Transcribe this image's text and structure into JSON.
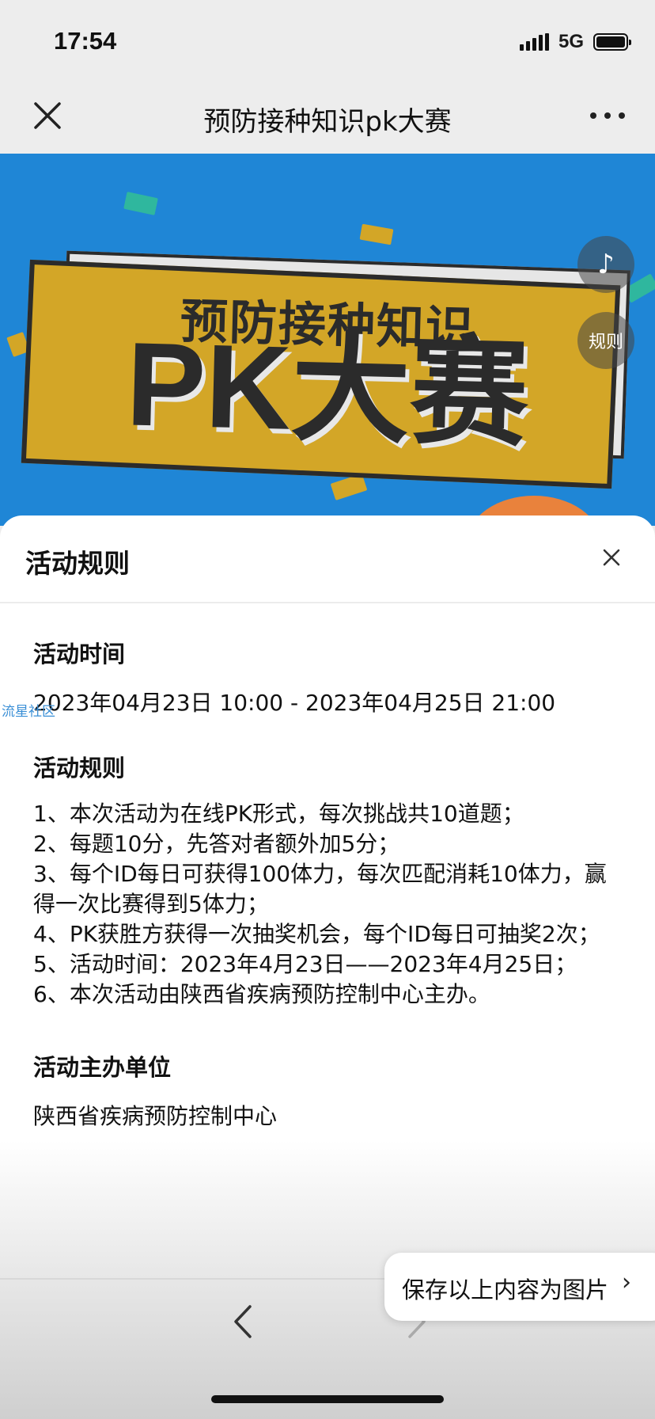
{
  "status": {
    "time": "17:54",
    "network": "5G",
    "icons": [
      "signal-icon",
      "battery-icon"
    ]
  },
  "nav": {
    "title": "预防接种知识pk大赛",
    "close_icon": "close-icon",
    "more_icon": "more-icon"
  },
  "banner": {
    "subtitle": "预防接种知识",
    "main": "PK大赛",
    "rule_button": "规则",
    "music_icon": "music-note-icon",
    "colors": {
      "background": "#1f86d6",
      "board": "#d3a627",
      "text": "#2b2b2b"
    }
  },
  "sheet": {
    "title": "活动规则",
    "sections": {
      "time": {
        "heading": "活动时间",
        "text": "2023年04月23日 10:00 - 2023年04月25日 21:00"
      },
      "rules": {
        "heading": "活动规则",
        "lines": [
          "1、本次活动为在线PK形式，每次挑战共10道题；",
          "2、每题10分，先答对者额外加5分；",
          "3、每个ID每日可获得100体力，每次匹配消耗10体力，赢得一次比赛得到5体力；",
          "4、PK获胜方获得一次抽奖机会，每个ID每日可抽奖2次；",
          "5、活动时间：2023年4月23日——2023年4月25日；",
          "6、本次活动由陕西省疾病预防控制中心主办。"
        ]
      },
      "organizer": {
        "heading": "活动主办单位",
        "text": "陕西省疾病预防控制中心"
      }
    },
    "watermark": "流星社区"
  },
  "bottom": {
    "save_label": "保存以上内容为图片",
    "save_chevron": "›",
    "back_icon": "chevron-left-icon",
    "forward_icon": "chevron-right-icon"
  }
}
